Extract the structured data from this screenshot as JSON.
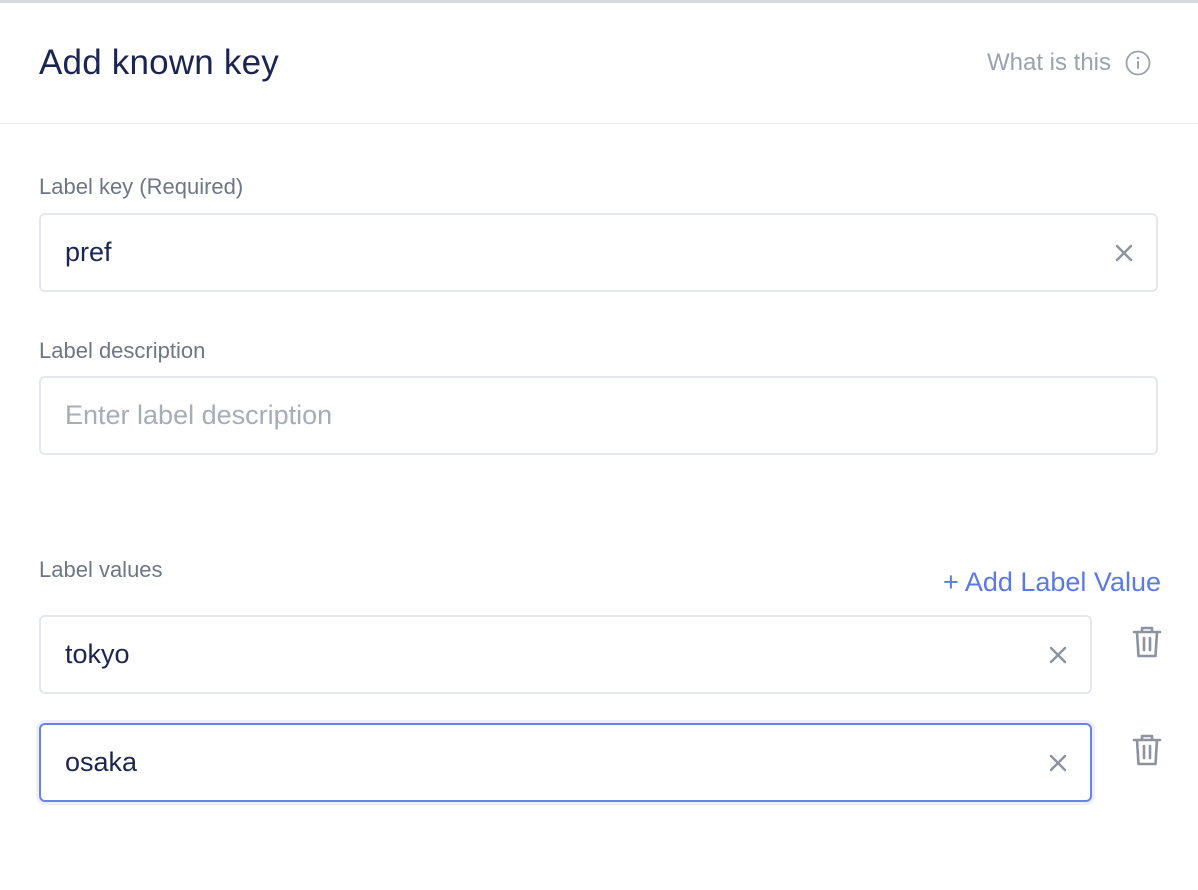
{
  "header": {
    "title": "Add known key",
    "help_label": "What is this"
  },
  "form": {
    "label_key": {
      "label": "Label key (Required)",
      "value": "pref"
    },
    "label_description": {
      "label": "Label description",
      "placeholder": "Enter label description",
      "value": ""
    },
    "label_values": {
      "label": "Label values",
      "add_label": "+ Add Label Value",
      "items": [
        {
          "value": "tokyo",
          "focused": false
        },
        {
          "value": "osaka",
          "focused": true
        }
      ]
    }
  },
  "colors": {
    "accent": "#5b79e8",
    "focus_border": "#6b82e8",
    "text_primary": "#1b2550",
    "text_muted": "#6e7685",
    "icon_muted": "#9aa2b0"
  },
  "icons": {
    "help": "info-icon",
    "clear": "close-icon",
    "delete": "trash-icon"
  }
}
